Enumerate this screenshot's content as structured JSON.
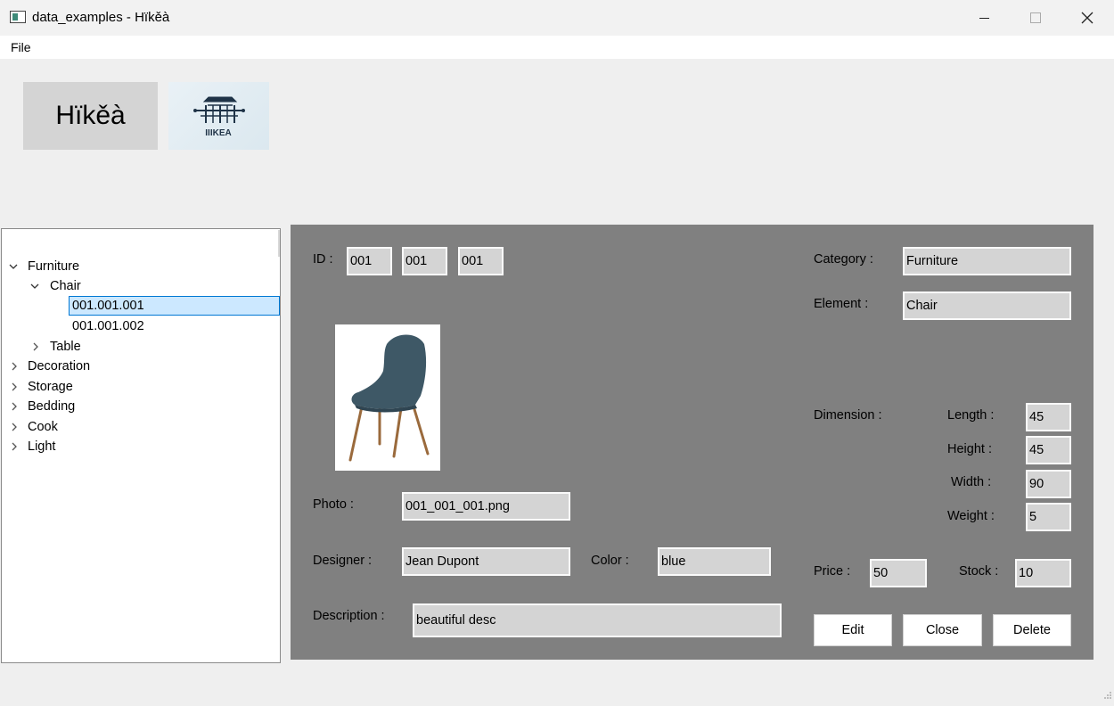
{
  "window": {
    "title": "data_examples - Hïkěà",
    "buttons": {
      "minimize": "—",
      "maximize": "□",
      "close": "✕"
    }
  },
  "menu": {
    "file": "File"
  },
  "header": {
    "brand": "Hïkěà",
    "logo_text": "IIIKEA"
  },
  "tree": {
    "items": [
      {
        "label": "Furniture",
        "expanded": true
      },
      {
        "label": "Chair",
        "expanded": true
      },
      {
        "label": "001.001.001",
        "selected": true
      },
      {
        "label": "001.001.002"
      },
      {
        "label": "Table",
        "expanded": false
      },
      {
        "label": "Decoration",
        "expanded": false
      },
      {
        "label": "Storage",
        "expanded": false
      },
      {
        "label": "Bedding",
        "expanded": false
      },
      {
        "label": "Cook",
        "expanded": false
      },
      {
        "label": "Light",
        "expanded": false
      }
    ]
  },
  "detail": {
    "id_label": "ID :",
    "id": [
      "001",
      "001",
      "001"
    ],
    "category_label": "Category :",
    "category": "Furniture",
    "element_label": "Element :",
    "element": "Chair",
    "photo_label": "Photo :",
    "photo": "001_001_001.png",
    "designer_label": "Designer :",
    "designer": "Jean Dupont",
    "color_label": "Color :",
    "color": "blue",
    "description_label": "Description :",
    "description": "beautiful desc",
    "dimension_label": "Dimension :",
    "length_label": "Length :",
    "length": "45",
    "height_label": "Height :",
    "height": "45",
    "width_label": "Width :",
    "width": "90",
    "weight_label": "Weight :",
    "weight": "5",
    "price_label": "Price :",
    "price": "50",
    "stock_label": "Stock :",
    "stock": "10"
  },
  "actions": {
    "edit": "Edit",
    "close": "Close",
    "delete": "Delete"
  },
  "colors": {
    "panel": "#808080",
    "field": "#d4d4d4",
    "selection": "#cce8ff",
    "selection_border": "#0078d4",
    "chair_seat": "#3e5866",
    "chair_legs": "#9a6a3c"
  }
}
